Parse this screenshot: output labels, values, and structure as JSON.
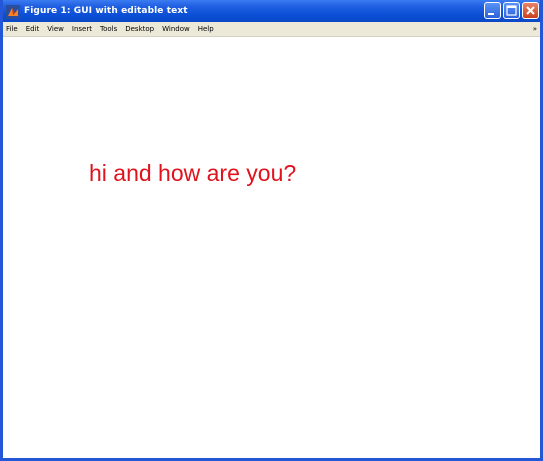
{
  "window": {
    "title": "Figure 1: GUI with editable text"
  },
  "menubar": {
    "items": [
      "File",
      "Edit",
      "View",
      "Insert",
      "Tools",
      "Desktop",
      "Window",
      "Help"
    ],
    "overflow_arrow": "»"
  },
  "canvas": {
    "text": "hi and how are you?",
    "text_color": "#e0121c"
  },
  "icons": {
    "app": "matlab-figure-icon",
    "minimize": "minimize-icon",
    "maximize": "maximize-icon",
    "close": "close-icon"
  },
  "colors": {
    "titlebar": "#0a4fd6",
    "menubar": "#ece9d8",
    "canvas": "#ffffff"
  }
}
